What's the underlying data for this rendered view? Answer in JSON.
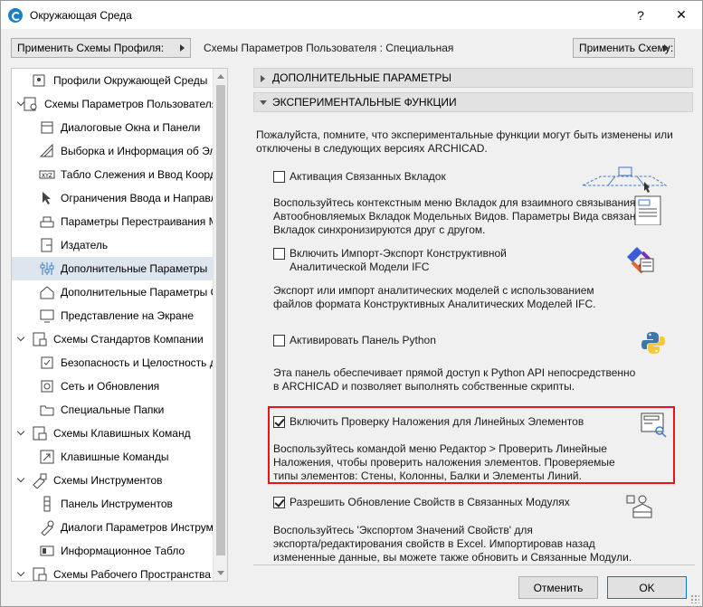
{
  "window": {
    "title": "Окружающая Среда",
    "help_label": "?",
    "close_label": "✕"
  },
  "toolbar": {
    "apply_profile_label": "Применить Схемы Профиля:",
    "user_schemes_label": "Схемы Параметров Пользователя :  Специальная",
    "apply_scheme_label": "Применить Схему:"
  },
  "tree": {
    "items": [
      {
        "label": "Профили Окружающей Среды",
        "icon": "profile-icon",
        "level": 0,
        "chevron": false
      },
      {
        "label": "Схемы Параметров Пользователя",
        "icon": "user-schemes-icon",
        "level": 0,
        "chevron": true
      },
      {
        "label": "Диалоговые Окна и Панели",
        "icon": "dialogs-icon",
        "level": 1
      },
      {
        "label": "Выборка и Информация об Эле",
        "icon": "selection-icon",
        "level": 1
      },
      {
        "label": "Табло Слежения и Ввод Коорди",
        "icon": "xyz-icon",
        "level": 1
      },
      {
        "label": "Ограничения Ввода и Направл",
        "icon": "cursor-icon",
        "level": 1
      },
      {
        "label": "Параметры Перестраивания Мо",
        "icon": "rebuild-icon",
        "level": 1
      },
      {
        "label": "Издатель",
        "icon": "publisher-icon",
        "level": 1
      },
      {
        "label": "Дополнительные Параметры",
        "icon": "sliders-icon",
        "level": 1,
        "selected": true
      },
      {
        "label": "Дополнительные Параметры О",
        "icon": "house-icon",
        "level": 1
      },
      {
        "label": "Представление на Экране",
        "icon": "display-icon",
        "level": 1
      },
      {
        "label": "Схемы Стандартов Компании",
        "icon": "company-icon",
        "level": 0,
        "chevron": true
      },
      {
        "label": "Безопасность и Целостность да",
        "icon": "security-icon",
        "level": 1
      },
      {
        "label": "Сеть и Обновления",
        "icon": "network-icon",
        "level": 1
      },
      {
        "label": "Специальные Папки",
        "icon": "folder-icon",
        "level": 1
      },
      {
        "label": "Схемы Клавишных Команд",
        "icon": "keyboard-schemes-icon",
        "level": 0,
        "chevron": true
      },
      {
        "label": "Клавишные Команды",
        "icon": "shortcut-icon",
        "level": 1
      },
      {
        "label": "Схемы Инструментов",
        "icon": "tools-schemes-icon",
        "level": 0,
        "chevron": true
      },
      {
        "label": "Панель Инструментов",
        "icon": "toolbar-icon",
        "level": 1
      },
      {
        "label": "Диалоги Параметров Инструме",
        "icon": "tool-settings-icon",
        "level": 1
      },
      {
        "label": "Информационное Табло",
        "icon": "info-box-icon",
        "level": 1
      },
      {
        "label": "Схемы Рабочего Пространства",
        "icon": "workspace-icon",
        "level": 0,
        "chevron": true
      }
    ]
  },
  "panel": {
    "section1": "ДОПОЛНИТЕЛЬНЫЕ ПАРАМЕТРЫ",
    "section2": "ЭКСПЕРИМЕНТАЛЬНЫЕ ФУНКЦИИ",
    "intro_line1": "Пожалуйста, помните, что экспериментальные функции могут быть изменены или",
    "intro_line2": "отключены в следующих версиях ARCHICAD.",
    "features": [
      {
        "label": "Активация Связанных Вкладок",
        "checked": false,
        "desc": [
          "Воспользуйтесь контекстным меню Вкладок для взаимного связывания",
          "Автообновляемых Вкладок Модельных Видов. Параметры Вида связанных",
          "Вкладок синхронизируются друг с другом."
        ],
        "icon": "linked-tabs-icon"
      },
      {
        "label": "Включить Импорт-Экспорт Конструктивной",
        "label2": "Аналитической Модели IFC",
        "checked": false,
        "desc": [
          "Экспорт или импорт аналитических моделей с использованием",
          "файлов формата Конструктивных Аналитических Моделей IFC."
        ],
        "icon": "ifc-icon"
      },
      {
        "label": "Активировать Панель Python",
        "checked": false,
        "desc": [
          "Эта панель обеспечивает прямой доступ к Python API непосредственно",
          "в ARCHICAD и позволяет выполнять собственные скрипты."
        ],
        "icon": "python-icon"
      },
      {
        "label": "Включить Проверку Наложения для Линейных Элементов",
        "checked": true,
        "desc": [
          "Воспользуйтесь командой меню Редактор > Проверить Линейные",
          "Наложения, чтобы проверить наложения элементов. Проверяемые",
          "типы элементов: Стены, Колонны, Балки и Элементы Линий."
        ],
        "icon": "overlap-check-icon"
      },
      {
        "label": "Разрешить Обновление Свойств в Связанных Модулях",
        "checked": true,
        "desc": [
          "Воспользуйтесь 'Экспортом Значений Свойств' для",
          "экспорта/редактирования свойств в Excel. Импортировав назад",
          "измененные данные, вы можете также обновить и Связанные Модули."
        ],
        "icon": "property-update-icon"
      }
    ]
  },
  "buttons": {
    "cancel": "Отменить",
    "ok": "OK"
  },
  "colors": {
    "highlight": "#e8161b",
    "selected_row": "#dde6ef",
    "accent": "#1a7fc4"
  }
}
